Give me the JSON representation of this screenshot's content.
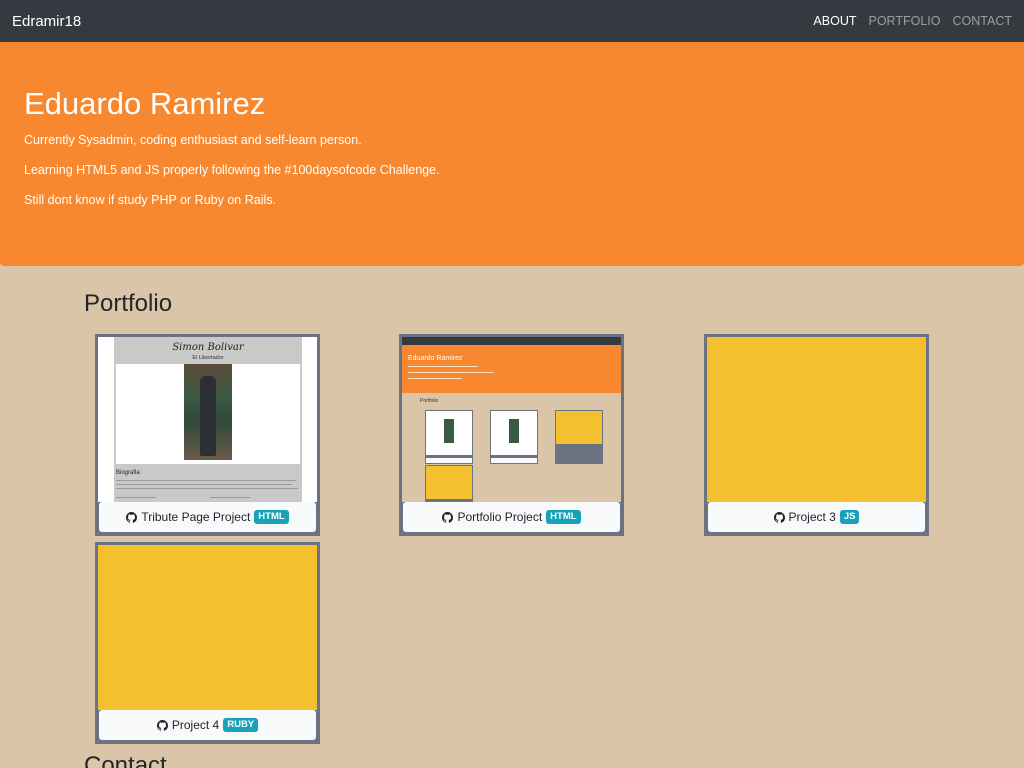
{
  "navbar": {
    "brand": "Edramir18",
    "links": [
      {
        "label": "ABOUT",
        "active": true
      },
      {
        "label": "PORTFOLIO",
        "active": false
      },
      {
        "label": "CONTACT",
        "active": false
      }
    ]
  },
  "hero": {
    "name": "Eduardo Ramirez",
    "lines": [
      "Currently Sysadmin, coding enthusiast and self-learn person.",
      "Learning HTML5 and JS properly following the #100daysofcode Challenge.",
      "Still dont know if study PHP or Ruby on Rails."
    ]
  },
  "portfolio": {
    "title": "Portfolio",
    "projects": [
      {
        "label": "Tribute Page Project",
        "badge": "HTML",
        "thumb": "tribute-page-screenshot"
      },
      {
        "label": "Portfolio Project",
        "badge": "HTML",
        "thumb": "portfolio-page-screenshot"
      },
      {
        "label": "Project 3",
        "badge": "JS",
        "thumb": "yellow-placeholder"
      },
      {
        "label": "Project 4",
        "badge": "RUBY",
        "thumb": "yellow-placeholder"
      }
    ],
    "tribute_thumb": {
      "title": "Simon Bolivar",
      "subtitle": "El Libertador",
      "section": "Biografia"
    },
    "portfolio_thumb": {
      "name": "Eduardo Ramirez",
      "section": "Portfolio"
    }
  },
  "contact": {
    "title": "Contact"
  },
  "colors": {
    "navbar": "#343a40",
    "hero": "#f7882f",
    "background": "#dbc5a9",
    "placeholder": "#f5c02f",
    "badge": "#17a2b8",
    "card_border": "#6c7380"
  }
}
